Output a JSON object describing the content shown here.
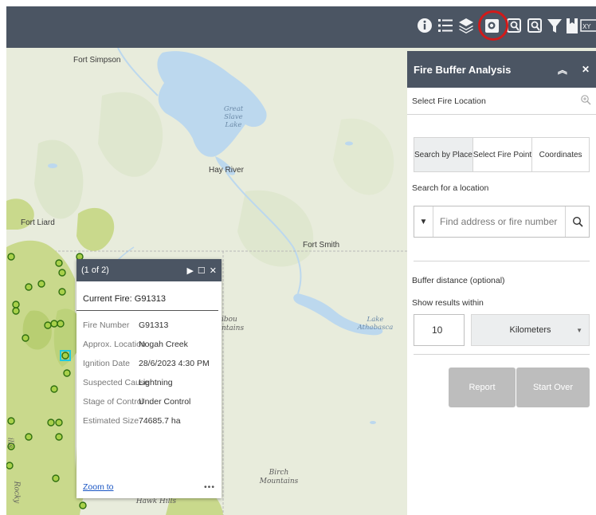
{
  "toolbar": {
    "tools": [
      {
        "icon": "info-icon",
        "glyph": "i"
      },
      {
        "icon": "legend-icon",
        "glyph": "☰"
      },
      {
        "icon": "layers-icon",
        "glyph": "◈"
      },
      {
        "icon": "fire-buffer-icon",
        "glyph": "◉"
      },
      {
        "icon": "query-icon",
        "glyph": "⊕"
      },
      {
        "icon": "query-2-icon",
        "glyph": "⊕"
      },
      {
        "icon": "filter-icon",
        "glyph": "▼"
      },
      {
        "icon": "bookmark-icon",
        "glyph": "▮"
      },
      {
        "icon": "coordinates-icon",
        "glyph": "XY"
      }
    ],
    "highlight_color": "#d11a1a"
  },
  "map": {
    "places": {
      "fort_simpson": "Fort Simpson",
      "hay_river": "Hay River",
      "fort_liard": "Fort Liard",
      "fort_smith": "Fort Smith"
    },
    "water": {
      "great_slave_1": "Great",
      "great_slave_2": "Slave",
      "great_slave_3": "Lake",
      "athabasca_1": "Lake",
      "athabasca_2": "Athabasca"
    },
    "terrain": {
      "caribou_1": "ibou",
      "caribou_2": "ntains",
      "birch_1": "Birch",
      "birch_2": "Mountains",
      "hawk_hills": "Hawk Hills",
      "rocky": "Rocky",
      "ills": "ills"
    },
    "fire_color": "#a8d04a",
    "fire_outline": "#2f6f10",
    "selected_outline": "#1fc8e0"
  },
  "popup": {
    "count": "(1 of 2)",
    "title": "Current Fire: G91313",
    "attributes": [
      {
        "key": "Fire Number",
        "value": "G91313"
      },
      {
        "key": "Approx. Location",
        "value": "Nogah Creek"
      },
      {
        "key": "Ignition Date",
        "value": "28/6/2023 4:30 PM"
      },
      {
        "key": "Suspected Cause",
        "value": "Lightning"
      },
      {
        "key": "Stage of Control",
        "value": "Under Control"
      },
      {
        "key": "Estimated Size",
        "value": "74685.7 ha"
      }
    ],
    "zoom_label": "Zoom to",
    "more_label": "•••"
  },
  "panel": {
    "title": "Fire Buffer Analysis",
    "select_location_label": "Select Fire Location",
    "tabs": [
      "Search by Place",
      "Select Fire Point",
      "Coordinates"
    ],
    "active_tab": 0,
    "search_label": "Search for a location",
    "search_placeholder": "Find address or fire number",
    "buffer_label": "Buffer distance (optional)",
    "show_within_label": "Show results within",
    "distance_value": "10",
    "distance_unit": "Kilometers",
    "report_button": "Report",
    "start_over_button": "Start Over",
    "header_color": "#4b5563"
  }
}
